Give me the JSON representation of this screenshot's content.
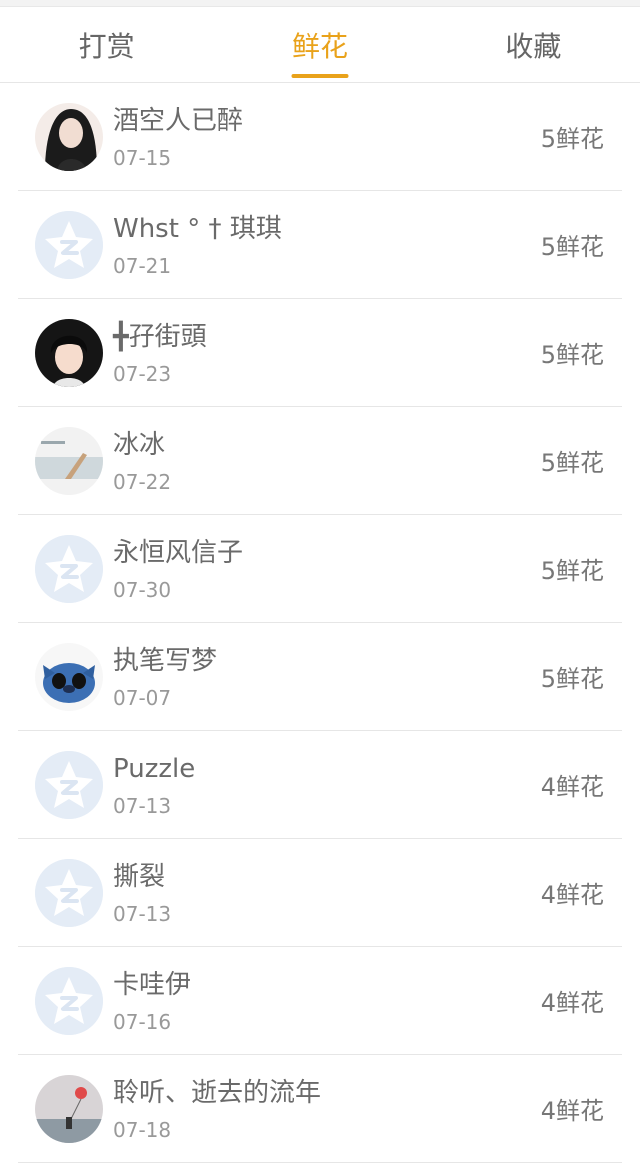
{
  "tabs": [
    {
      "label": "打赏",
      "active": false
    },
    {
      "label": "鲜花",
      "active": true
    },
    {
      "label": "收藏",
      "active": false
    }
  ],
  "accent_color": "#e9a21a",
  "items": [
    {
      "name": "酒空人已醉",
      "date": "07-15",
      "count": "5鲜花",
      "avatar": "portrait-woman"
    },
    {
      "name": "Whst ° † 琪琪",
      "date": "07-21",
      "count": "5鲜花",
      "avatar": "default-star-icon"
    },
    {
      "name": "╋孖街頭",
      "date": "07-23",
      "count": "5鲜花",
      "avatar": "portrait-boy"
    },
    {
      "name": "冰冰",
      "date": "07-22",
      "count": "5鲜花",
      "avatar": "scenery-photo"
    },
    {
      "name": "永恒风信子",
      "date": "07-30",
      "count": "5鲜花",
      "avatar": "default-star-icon"
    },
    {
      "name": "执笔写梦",
      "date": "07-07",
      "count": "5鲜花",
      "avatar": "cartoon-stitch"
    },
    {
      "name": "Puzzle",
      "date": "07-13",
      "count": "4鲜花",
      "avatar": "default-star-icon"
    },
    {
      "name": "撕裂",
      "date": "07-13",
      "count": "4鲜花",
      "avatar": "default-star-icon"
    },
    {
      "name": "卡哇伊",
      "date": "07-16",
      "count": "4鲜花",
      "avatar": "default-star-icon"
    },
    {
      "name": "聆听、逝去的流年",
      "date": "07-18",
      "count": "4鲜花",
      "avatar": "balloon-photo"
    }
  ]
}
